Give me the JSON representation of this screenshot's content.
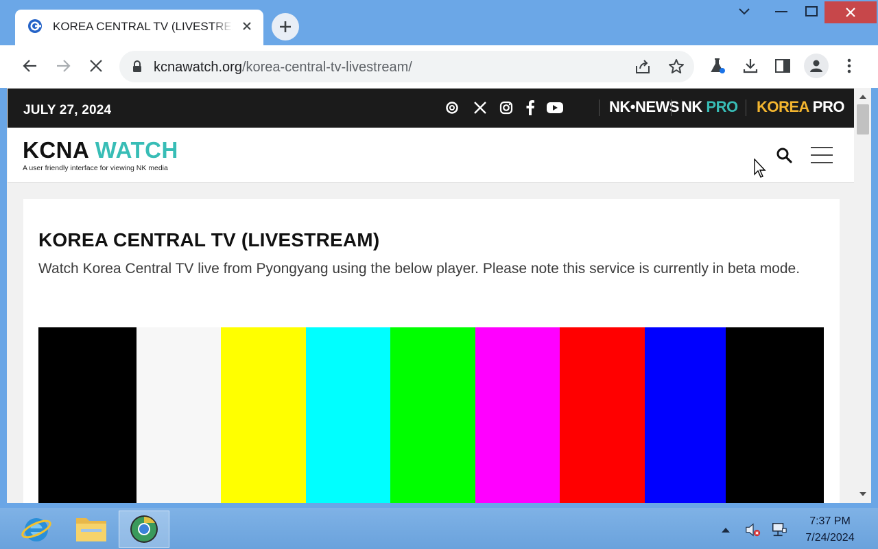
{
  "browser": {
    "tab_title": "KOREA CENTRAL TV (LIVESTREAM)",
    "url_domain": "kcnawatch.org",
    "url_path": "/korea-central-tv-livestream/"
  },
  "site": {
    "date": "JULY 27, 2024",
    "brands": {
      "nk_news": "NK•NEWS",
      "nk_pro_a": "NK",
      "nk_pro_b": "PRO",
      "korea_pro_a": "KOREA",
      "korea_pro_b": "PRO"
    },
    "logo_a": "KCNA",
    "logo_b": "WATCH",
    "tagline": "A user friendly interface for viewing NK media"
  },
  "content": {
    "title": "KOREA CENTRAL TV (LIVESTREAM)",
    "description": "Watch Korea Central TV live from Pyongyang using the below player. Please note this service is currently in beta mode."
  },
  "player": {
    "color_bars": [
      "#000000",
      "#f7f7f7",
      "#ffff00",
      "#00ffff",
      "#00ff00",
      "#ff00ff",
      "#ff0000",
      "#0000ff",
      "#000000"
    ]
  },
  "taskbar": {
    "apps": [
      "internet-explorer-icon",
      "file-explorer-icon",
      "chrome-canary-icon"
    ],
    "time": "7:37 PM",
    "date": "7/24/2024"
  },
  "colors": {
    "teal": "#38bdb6",
    "gold": "#f3b52f",
    "titlebar": "#6ba7e7",
    "close_red": "#c7474a"
  }
}
